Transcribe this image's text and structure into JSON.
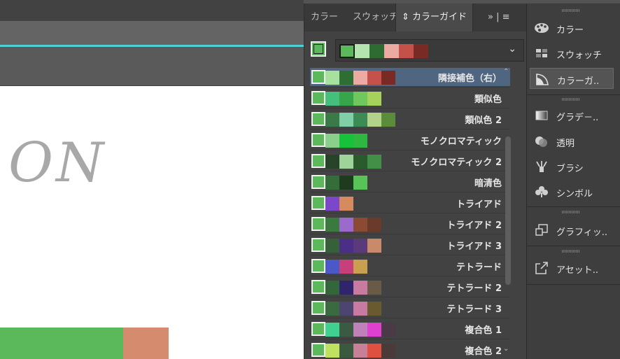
{
  "panel": {
    "tabs": [
      {
        "label": "カラー"
      },
      {
        "label": "スウォッチ"
      },
      {
        "label": "⇕ カラーガイド"
      }
    ],
    "tab_menu": "»  |  ≡",
    "dropdown_chevron": "⌄",
    "current_color": "#5bb85b",
    "active_harmony_colors": [
      "#b6e4b0",
      "#2e6b32",
      "#edaaa2",
      "#c4524a",
      "#7a2a24"
    ]
  },
  "harmonies": [
    {
      "label": "隣接補色（右）",
      "colors": [
        "#a8e0a0",
        "#2f6e33",
        "#ecaaa2",
        "#c4524a",
        "#7a2a24"
      ]
    },
    {
      "label": "類似色",
      "colors": [
        "#45c07c",
        "#37a64b",
        "#6fc75d",
        "#a6d15a"
      ]
    },
    {
      "label": "類似色 2",
      "colors": [
        "#3a7a48",
        "#7fcfa8",
        "#3c8a55",
        "#b3d28a",
        "#5a8c3c"
      ]
    },
    {
      "label": "モノクロマティック",
      "colors": [
        "#8ad08a",
        "#16c23a",
        "#2fb83f"
      ]
    },
    {
      "label": "モノクロマティック 2",
      "colors": [
        "#27442a",
        "#9ed39a",
        "#2b5b2d",
        "#448f47"
      ]
    },
    {
      "label": "暗清色",
      "colors": [
        "#356d38",
        "#1e3b20",
        "#58c457"
      ]
    },
    {
      "label": "トライアド",
      "colors": [
        "#7a48c8",
        "#d58a60"
      ]
    },
    {
      "label": "トライアド 2",
      "colors": [
        "#3a7a3e",
        "#9a6acc",
        "#8a4a34",
        "#6a3a2a"
      ]
    },
    {
      "label": "トライアド 3",
      "colors": [
        "#375f3a",
        "#4b2e86",
        "#5a3a7a",
        "#c88a6a"
      ]
    },
    {
      "label": "テトラード",
      "colors": [
        "#4b59c8",
        "#c8407a",
        "#c8a050"
      ]
    },
    {
      "label": "テトラード 2",
      "colors": [
        "#33663a",
        "#30246a",
        "#c87aa0",
        "#6a5a48"
      ]
    },
    {
      "label": "テトラード 3",
      "colors": [
        "#3c6a40",
        "#4e4470",
        "#c87aa0",
        "#6a5a30"
      ]
    },
    {
      "label": "複合色 1",
      "colors": [
        "#40d090",
        "#3a5a44",
        "#c080b8",
        "#e040d0",
        "#4a3a48"
      ]
    },
    {
      "label": "複合色 2",
      "colors": [
        "#c0e060",
        "#3a5a40",
        "#c88098",
        "#e05040",
        "#4a3a3a"
      ]
    }
  ],
  "dock": {
    "items": [
      {
        "label": "カラー",
        "icon": "palette-icon"
      },
      {
        "label": "スウォッチ",
        "icon": "swatches-icon"
      },
      {
        "label": "カラーガ..",
        "icon": "color-guide-icon"
      },
      {
        "label": "グラデ－..",
        "icon": "gradient-icon"
      },
      {
        "label": "透明",
        "icon": "transparency-icon"
      },
      {
        "label": "ブラシ",
        "icon": "brush-icon"
      },
      {
        "label": "シンボル",
        "icon": "symbol-icon"
      },
      {
        "label": "グラフィッ..",
        "icon": "graphic-styles-icon"
      },
      {
        "label": "アセット..",
        "icon": "asset-export-icon"
      }
    ]
  },
  "canvas": {
    "text": "ON"
  },
  "colors": {
    "selection": "#4f6580",
    "accent_line": "#4dd0d6"
  }
}
